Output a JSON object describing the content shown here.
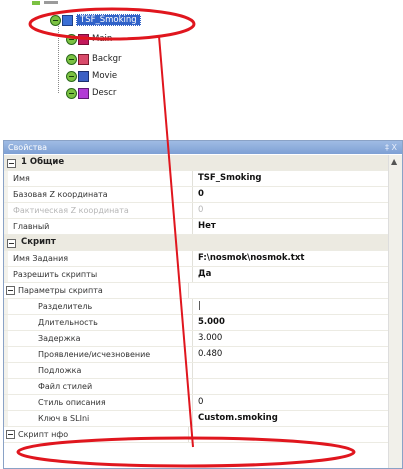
{
  "tree": {
    "nodes": [
      {
        "label": "TSF_Smoking",
        "selected": true,
        "icon": "folder-icon"
      },
      {
        "label": "Main",
        "icon": "main-icon"
      },
      {
        "label": "Backgr",
        "icon": "background-icon"
      },
      {
        "label": "Movie",
        "icon": "movie-icon"
      },
      {
        "label": "Descr",
        "icon": "description-icon"
      }
    ]
  },
  "panel": {
    "title": "Свойства",
    "pin_label": "‡ X",
    "categories": [
      {
        "label": "1 Общие"
      },
      {
        "label": "Скрипт"
      }
    ],
    "rows": {
      "name": {
        "label": "Имя",
        "value": "TSF_Smoking"
      },
      "base_z": {
        "label": "Базовая Z координата",
        "value": "0"
      },
      "actual_z": {
        "label": "Фактическая Z координата",
        "value": "0"
      },
      "main": {
        "label": "Главный",
        "value": "Нет"
      },
      "task_name": {
        "label": "Имя Задания",
        "value": "F:\\nosmok\\nosmok.txt"
      },
      "allow": {
        "label": "Разрешить скрипты",
        "value": "Да"
      },
      "params": {
        "label": "Параметры скрипта",
        "value": ""
      },
      "separator": {
        "label": "Разделитель",
        "value": "|"
      },
      "duration": {
        "label": "Длительность",
        "value": "5.000"
      },
      "delay": {
        "label": "Задержка",
        "value": "3.000"
      },
      "fade": {
        "label": "Проявление/исчезновение",
        "value": "0.480"
      },
      "substrate": {
        "label": "Подложка",
        "value": ""
      },
      "style_file": {
        "label": "Файл стилей",
        "value": ""
      },
      "descr_style": {
        "label": "Стиль описания",
        "value": "0"
      },
      "key": {
        "label": "Ключ в SLIni",
        "value": "Custom.smoking"
      },
      "partial": {
        "label": "Скрипт нфо",
        "value": ""
      }
    }
  },
  "colors": {
    "annotation": "#e0161e",
    "selection": "#3162c8",
    "title_bar": "#8aa9d9"
  }
}
